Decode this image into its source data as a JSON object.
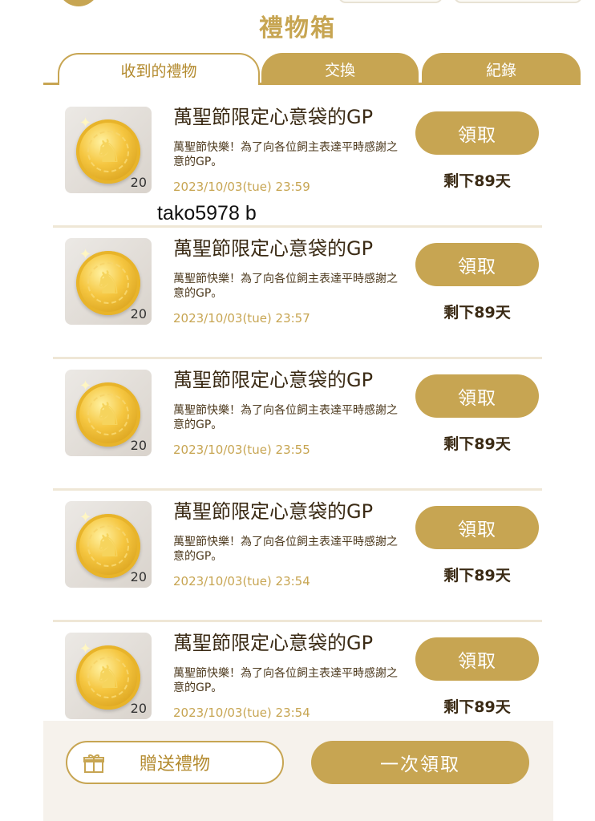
{
  "header": {
    "title": "禮物箱"
  },
  "tabs": [
    {
      "label": "收到的禮物"
    },
    {
      "label": "交換"
    },
    {
      "label": "紀錄"
    }
  ],
  "items": [
    {
      "title": "萬聖節限定心意袋的GP",
      "description": "萬聖節快樂！為了向各位飼主表達平時感謝之意的GP。",
      "date": "2023/10/03(tue) 23:59",
      "count": "20",
      "button": "領取",
      "remaining": "剩下89天"
    },
    {
      "title": "萬聖節限定心意袋的GP",
      "description": "萬聖節快樂！為了向各位飼主表達平時感謝之意的GP。",
      "date": "2023/10/03(tue) 23:57",
      "count": "20",
      "button": "領取",
      "remaining": "剩下89天"
    },
    {
      "title": "萬聖節限定心意袋的GP",
      "description": "萬聖節快樂！為了向各位飼主表達平時感謝之意的GP。",
      "date": "2023/10/03(tue) 23:55",
      "count": "20",
      "button": "領取",
      "remaining": "剩下89天"
    },
    {
      "title": "萬聖節限定心意袋的GP",
      "description": "萬聖節快樂！為了向各位飼主表達平時感謝之意的GP。",
      "date": "2023/10/03(tue) 23:54",
      "count": "20",
      "button": "領取",
      "remaining": "剩下89天"
    },
    {
      "title": "萬聖節限定心意袋的GP",
      "description": "萬聖節快樂！為了向各位飼主表達平時感謝之意的GP。",
      "date": "2023/10/03(tue) 23:54",
      "count": "20",
      "button": "領取",
      "remaining": "剩下89天"
    }
  ],
  "watermark": "tako5978  b",
  "bottom": {
    "gift_label": "贈送禮物",
    "claim_all_label": "一次領取"
  },
  "icons": {
    "coin": "gold-coin-icon",
    "gift": "gift-icon"
  },
  "colors": {
    "accent": "#c7a552",
    "text": "#3a2a14",
    "date": "#c7a552"
  }
}
